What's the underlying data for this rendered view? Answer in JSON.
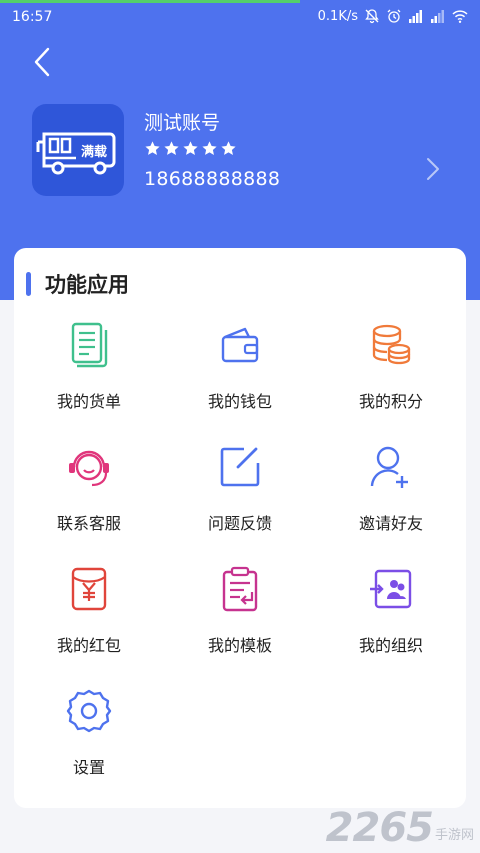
{
  "status_bar": {
    "time": "16:57",
    "net_speed": "0.1K/s",
    "icons": [
      "mute-bell-icon",
      "alarm-icon",
      "signal-icon",
      "signal-icon",
      "wifi-icon"
    ]
  },
  "header": {
    "back_icon": "chevron-left-icon",
    "account_name": "测试账号",
    "star_count": 5,
    "phone": "18688888888",
    "avatar_icon": "bus-logo-icon",
    "avatar_text": "满载",
    "forward_icon": "chevron-right-icon",
    "colors": {
      "header_bg": "#4e72ee",
      "avatar_bg": "#2f56d9"
    }
  },
  "section": {
    "title": "功能应用"
  },
  "functions": [
    {
      "label": "我的货单",
      "icon": "document-list-icon",
      "color": "#3fc08d"
    },
    {
      "label": "我的钱包",
      "icon": "wallet-icon",
      "color": "#4e72ee"
    },
    {
      "label": "我的积分",
      "icon": "coins-stack-icon",
      "color": "#f07a3a"
    },
    {
      "label": "联系客服",
      "icon": "headset-icon",
      "color": "#e0357b"
    },
    {
      "label": "问题反馈",
      "icon": "edit-square-icon",
      "color": "#4e72ee"
    },
    {
      "label": "邀请好友",
      "icon": "add-user-icon",
      "color": "#4e72ee"
    },
    {
      "label": "我的红包",
      "icon": "red-envelope-icon",
      "color": "#e0453b"
    },
    {
      "label": "我的模板",
      "icon": "clipboard-template-icon",
      "color": "#c6338f"
    },
    {
      "label": "我的组织",
      "icon": "organization-icon",
      "color": "#7b4ee6"
    },
    {
      "label": "设置",
      "icon": "gear-icon",
      "color": "#4e72ee"
    }
  ],
  "watermark": {
    "number": "2265",
    "text": "手游网"
  }
}
